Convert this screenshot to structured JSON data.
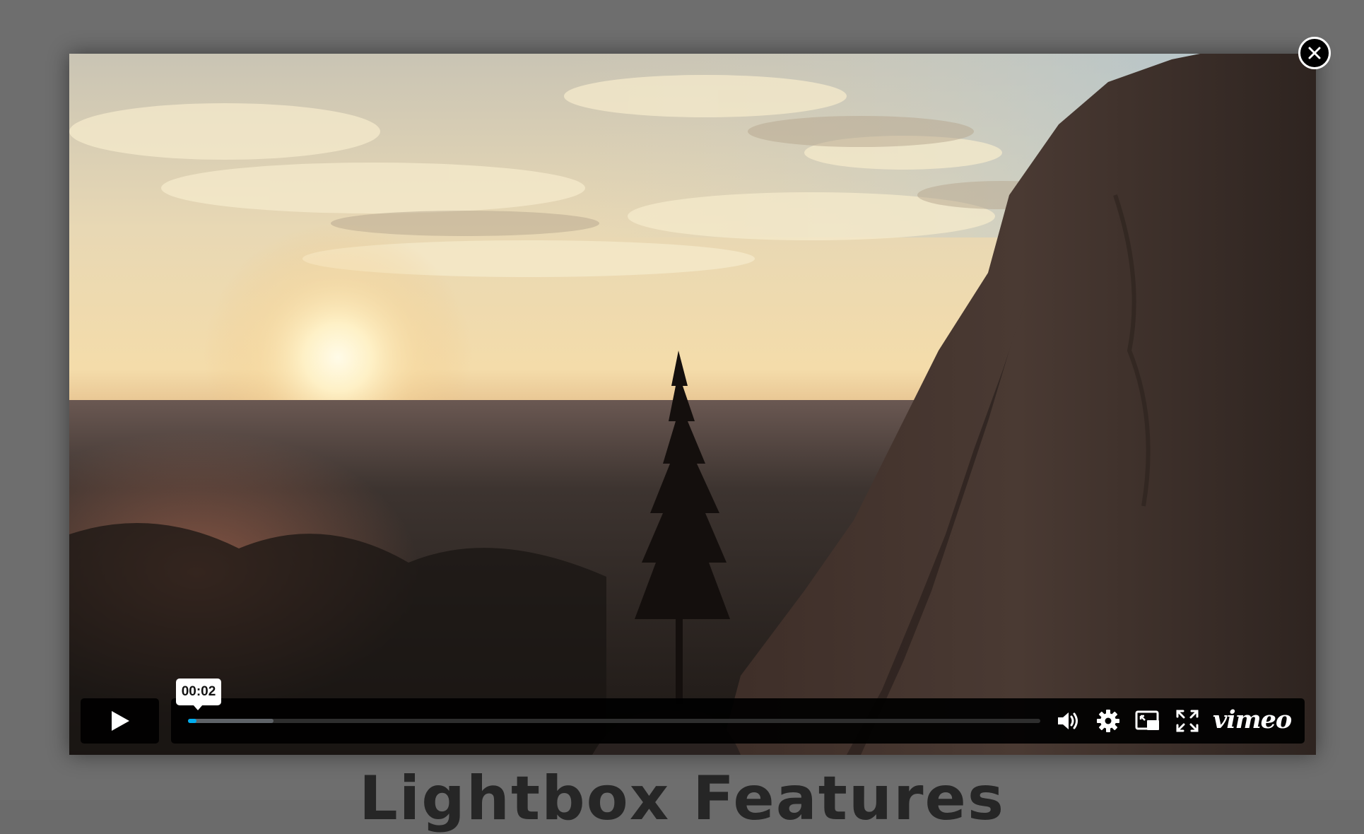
{
  "page": {
    "background_heading": "Lightbox Features"
  },
  "player": {
    "tooltip_time": "00:02",
    "progress": {
      "played_fraction": 0.008,
      "buffered_fraction": 0.1
    },
    "controls": {
      "play_icon": "play-icon",
      "volume_icon": "volume-icon",
      "settings_icon": "gear-icon",
      "pip_icon": "picture-in-picture-icon",
      "fullscreen_icon": "fullscreen-icon",
      "close_icon": "close-icon"
    },
    "brand": "vimeo",
    "colors": {
      "accent": "#00adef",
      "bar": "#000000",
      "overlay": "#6b6b6b"
    }
  }
}
